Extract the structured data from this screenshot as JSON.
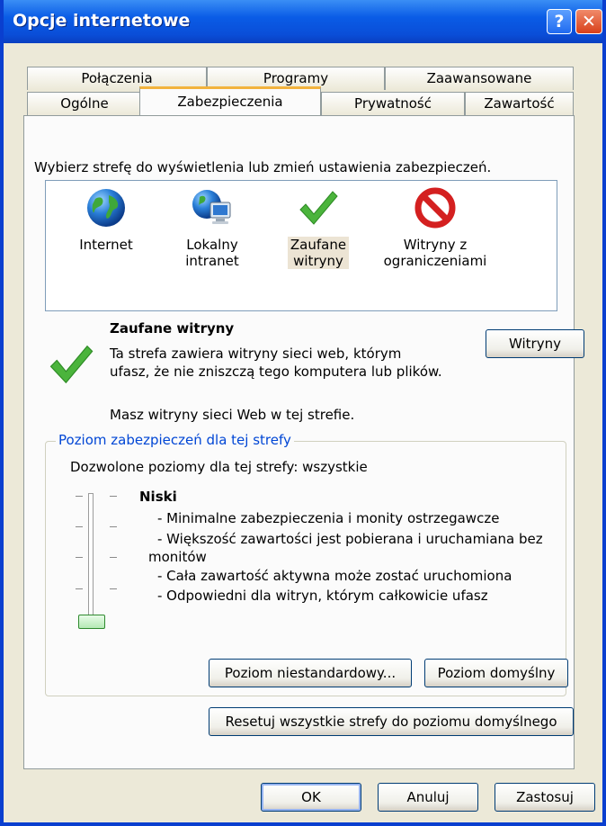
{
  "window": {
    "title": "Opcje internetowe",
    "help_glyph": "?",
    "close_glyph": "✕"
  },
  "tabs_row1": [
    {
      "label": "Połączenia"
    },
    {
      "label": "Programy"
    },
    {
      "label": "Zaawansowane"
    }
  ],
  "tabs_row2": [
    {
      "label": "Ogólne"
    },
    {
      "label": "Zabezpieczenia",
      "active": true
    },
    {
      "label": "Prywatność"
    },
    {
      "label": "Zawartość"
    }
  ],
  "security": {
    "instruction": "Wybierz strefę do wyświetlenia lub zmień ustawienia zabezpieczeń.",
    "zones": [
      {
        "line1": "Internet",
        "line2": "",
        "icon": "globe-icon"
      },
      {
        "line1": "Lokalny",
        "line2": "intranet",
        "icon": "intranet-icon"
      },
      {
        "line1": "Zaufane",
        "line2": "witryny",
        "icon": "checkmark-icon",
        "selected": true
      },
      {
        "line1": "Witryny z",
        "line2": "ograniczeniami",
        "icon": "prohibited-icon"
      }
    ],
    "selected_zone_title": "Zaufane witryny",
    "selected_zone_desc1": "Ta strefa zawiera witryny sieci web, którym",
    "selected_zone_desc2": "ufasz, że nie zniszczą tego komputera lub plików.",
    "sites_button": "Witryny",
    "sites_note": "Masz witryny sieci Web w tej strefie.",
    "level_group_title": "Poziom zabezpieczeń dla tej strefy",
    "allowed_levels": "Dozwolone poziomy dla tej strefy: wszystkie",
    "level_name": "Niski",
    "level_lines": [
      "- Minimalne zabezpieczenia i monity ostrzegawcze",
      "- Większość zawartości jest pobierana i uruchamiana bez",
      "monitów",
      "- Cała zawartość aktywna może zostać uruchomiona",
      "- Odpowiedni dla witryn, którym całkowicie ufasz"
    ],
    "slider_level": "1 of 5",
    "custom_level_button": "Poziom niestandardowy...",
    "default_level_button": "Poziom domyślny",
    "reset_all_button": "Resetuj wszystkie strefy do poziomu domyślnego"
  },
  "footer": {
    "ok": "OK",
    "cancel": "Anuluj",
    "apply": "Zastosuj"
  },
  "colors": {
    "titlebar": "#0a4ed8",
    "accent_tab": "#f2b33d",
    "group_title": "#0046d5",
    "check_green": "#4bb43c",
    "prohibited_red": "#d42020"
  }
}
